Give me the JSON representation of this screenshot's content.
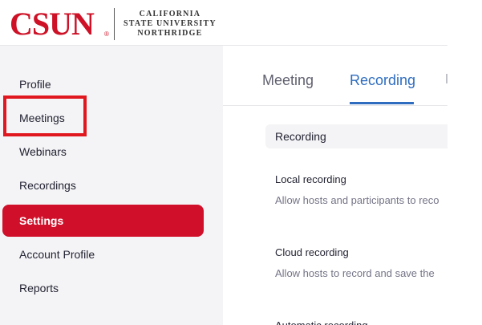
{
  "header": {
    "logo_word": "CSUN",
    "logo_reg": "®",
    "logo_line1": "CALIFORNIA",
    "logo_line2": "STATE UNIVERSITY",
    "logo_line3": "NORTHRIDGE"
  },
  "sidebar": {
    "items": [
      {
        "label": "Profile"
      },
      {
        "label": "Meetings"
      },
      {
        "label": "Webinars"
      },
      {
        "label": "Recordings"
      },
      {
        "label": "Settings"
      },
      {
        "label": "Account Profile"
      },
      {
        "label": "Reports"
      }
    ]
  },
  "tabs": [
    {
      "label": "Meeting"
    },
    {
      "label": "Recording"
    }
  ],
  "main": {
    "section_label": "Recording",
    "settings": [
      {
        "title": "Local recording",
        "description": "Allow hosts and participants to reco"
      },
      {
        "title": "Cloud recording",
        "description": "Allow hosts to record and save the"
      },
      {
        "title": "Automatic recording"
      }
    ]
  },
  "colors": {
    "brand_red": "#ce1126",
    "active_nav": "#d0102a",
    "tab_active": "#2d6cbf",
    "highlight_box": "#e0171f"
  }
}
